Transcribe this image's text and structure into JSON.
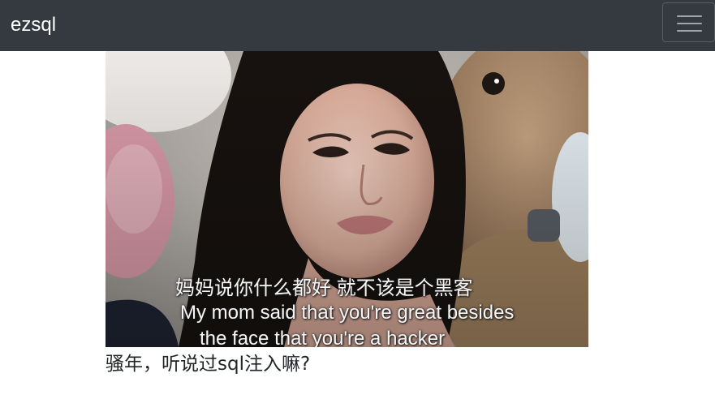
{
  "navbar": {
    "brand": "ezsql",
    "menu_icon": "hamburger-menu-icon",
    "background": "#343a40"
  },
  "meme": {
    "caption_zh": "妈妈说你什么都好 就不该是个黑客",
    "caption_en_line1": "My mom said that you're great besides",
    "caption_en_line2": "the face that you're a hacker"
  },
  "main": {
    "question": "骚年，听说过sql注入嘛?"
  }
}
